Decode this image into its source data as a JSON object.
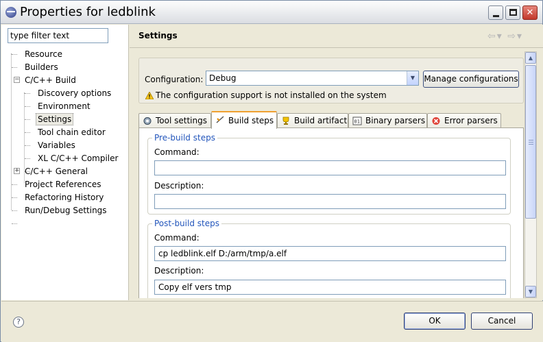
{
  "window": {
    "title": "Properties for ledblink",
    "controls": [
      "minimize",
      "maximize",
      "close"
    ]
  },
  "sidebar": {
    "filter_placeholder": "type filter text",
    "items": [
      {
        "label": "Resource",
        "level": 0
      },
      {
        "label": "Builders",
        "level": 0
      },
      {
        "label": "C/C++ Build",
        "level": 0,
        "expander": "minus"
      },
      {
        "label": "Discovery options",
        "level": 1
      },
      {
        "label": "Environment",
        "level": 1
      },
      {
        "label": "Settings",
        "level": 1,
        "selected": true
      },
      {
        "label": "Tool chain editor",
        "level": 1
      },
      {
        "label": "Variables",
        "level": 1
      },
      {
        "label": "XL C/C++ Compiler",
        "level": 1
      },
      {
        "label": "C/C++ General",
        "level": 0,
        "expander": "plus"
      },
      {
        "label": "Project References",
        "level": 0
      },
      {
        "label": "Refactoring History",
        "level": 0
      },
      {
        "label": "Run/Debug Settings",
        "level": 0
      }
    ]
  },
  "header": {
    "title": "Settings"
  },
  "configuration": {
    "label": "Configuration:",
    "value": "Debug",
    "manage_label": "Manage configurations",
    "warning": "The configuration support is not installed on the system"
  },
  "tabs": [
    {
      "label": "Tool settings",
      "icon": "tool-icon"
    },
    {
      "label": "Build steps",
      "icon": "build-steps-icon",
      "active": true
    },
    {
      "label": "Build artifact",
      "icon": "trophy-icon"
    },
    {
      "label": "Binary parsers",
      "icon": "binary-icon"
    },
    {
      "label": "Error parsers",
      "icon": "error-icon"
    }
  ],
  "pre_build": {
    "title": "Pre-build steps",
    "command_label": "Command:",
    "command_value": "",
    "description_label": "Description:",
    "description_value": ""
  },
  "post_build": {
    "title": "Post-build steps",
    "command_label": "Command:",
    "command_value": "cp ledblink.elf  D:/arm/tmp/a.elf",
    "description_label": "Description:",
    "description_value": "Copy elf vers tmp"
  },
  "buttons": {
    "ok": "OK",
    "cancel": "Cancel",
    "help": "?"
  },
  "colors": {
    "group_title": "#2255bb",
    "active_tab_accent": "#f0a030",
    "close_button": "#c2382b"
  }
}
